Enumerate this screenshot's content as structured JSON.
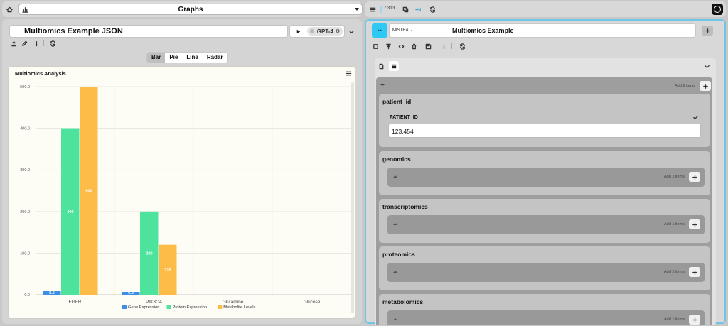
{
  "left_top": {
    "title": "Graphs"
  },
  "right_top": {
    "page_counter": "/ 313"
  },
  "left_panel": {
    "doc_title": "Multiomics Example JSON",
    "model": "GPT-4",
    "chart_tabs": [
      "Bar",
      "Pie",
      "Line",
      "Radar"
    ],
    "active_tab": "Bar"
  },
  "chart_data": {
    "type": "bar",
    "title": "Multiomics Analysis",
    "categories": [
      "EGFR",
      "PIK3CA",
      "Glutamine",
      "Glucose"
    ],
    "series": [
      {
        "name": "Gene Expression",
        "color": "#3b8fe6",
        "values": [
          8.5,
          6.2,
          0,
          0
        ],
        "labels": [
          "8.5",
          "6.2",
          "",
          ""
        ]
      },
      {
        "name": "Protein Expression",
        "color": "#4de39c",
        "values": [
          400,
          200,
          0,
          0
        ],
        "labels": [
          "400",
          "200",
          "",
          ""
        ]
      },
      {
        "name": "Metabolite Levels",
        "color": "#fdbb47",
        "values": [
          500,
          120,
          0,
          0
        ],
        "labels": [
          "500",
          "120",
          "",
          ""
        ]
      }
    ],
    "yticks": [
      "0.0",
      "100.0",
      "200.0",
      "300.0",
      "400.0",
      "500.0"
    ],
    "ylim": [
      0,
      500
    ],
    "grid": true,
    "legend_position": "bottom"
  },
  "right_panel": {
    "model_short": "MISTRAL-...",
    "title": "Multiomics Example",
    "root_add_label": "Add 6 items",
    "fields": [
      {
        "name": "patient_id",
        "sub_label": "PATIENT_ID",
        "value": "123,454"
      },
      {
        "name": "genomics",
        "add_label": "Add 2 items"
      },
      {
        "name": "transcriptomics",
        "add_label": "Add 1 items"
      },
      {
        "name": "proteomics",
        "add_label": "Add 2 items"
      },
      {
        "name": "metabolomics",
        "add_label": "Add 1 items"
      }
    ]
  },
  "colors": {
    "accent": "#2ec8f4",
    "border_accent": "#6ec6e6"
  }
}
